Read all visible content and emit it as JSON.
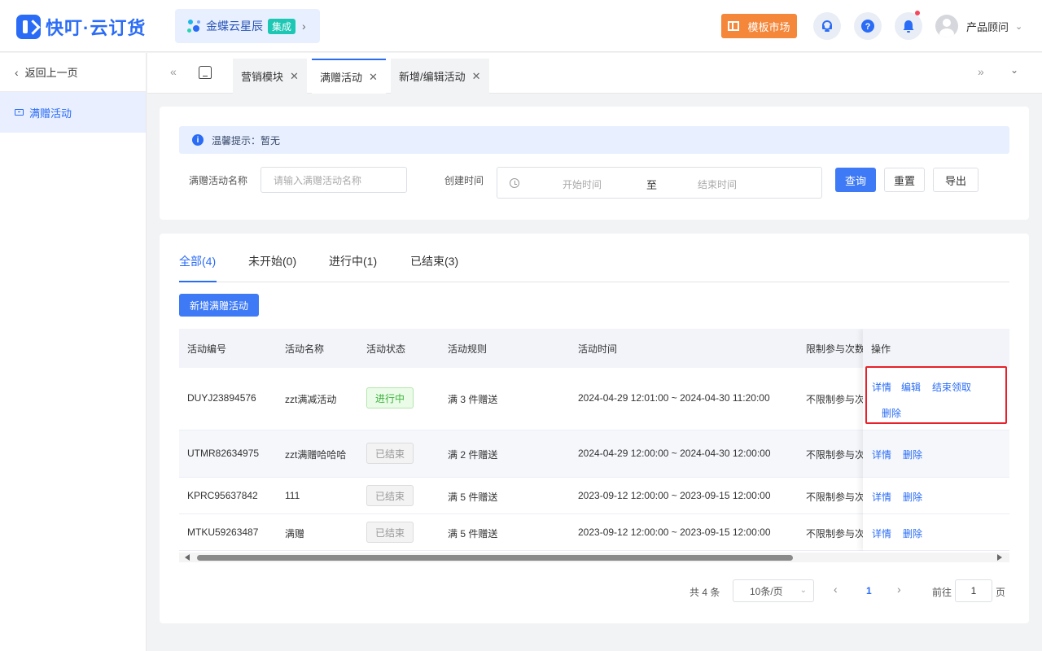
{
  "header": {
    "logo_text": "快叮·云订货",
    "tenant_name": "金蝶云星辰",
    "tenant_badge": "集成",
    "market_label": "模板市场",
    "user_name": "产品顾问"
  },
  "sidebar": {
    "back_label": "返回上一页",
    "items": [
      {
        "label": "满赠活动"
      }
    ]
  },
  "tabs": [
    {
      "label": "营销模块"
    },
    {
      "label": "满赠活动"
    },
    {
      "label": "新增/编辑活动"
    }
  ],
  "filter": {
    "tip_text": "温馨提示：暂无",
    "name_label": "满赠活动名称",
    "name_placeholder": "请输入满赠活动名称",
    "time_label": "创建时间",
    "start_placeholder": "开始时间",
    "range_sep": "至",
    "end_placeholder": "结束时间",
    "query_btn": "查询",
    "reset_btn": "重置",
    "export_btn": "导出"
  },
  "status_tabs": [
    {
      "label": "全部(4)"
    },
    {
      "label": "未开始(0)"
    },
    {
      "label": "进行中(1)"
    },
    {
      "label": "已结束(3)"
    }
  ],
  "add_btn": "新增满赠活动",
  "table": {
    "headers": [
      "活动编号",
      "活动名称",
      "活动状态",
      "活动规则",
      "活动时间",
      "限制参与次数",
      "操作"
    ],
    "rows": [
      {
        "code": "DUYJ23894576",
        "name": "zzt满减活动",
        "status": "进行中",
        "rule": "满 3 件赠送",
        "time": "2024-04-29 12:01:00 ~ 2024-04-30 11:20:00",
        "limit": "不限制参与次数",
        "ops": [
          "详情",
          "编辑",
          "结束领取",
          "删除"
        ]
      },
      {
        "code": "UTMR82634975",
        "name": "zzt满赠哈哈哈",
        "status": "已结束",
        "rule": "满 2 件赠送",
        "time": "2024-04-29 12:00:00 ~ 2024-04-30 12:00:00",
        "limit": "不限制参与次数",
        "ops": [
          "详情",
          "删除"
        ]
      },
      {
        "code": "KPRC95637842",
        "name": "111",
        "status": "已结束",
        "rule": "满 5 件赠送",
        "time": "2023-09-12 12:00:00 ~ 2023-09-15 12:00:00",
        "limit": "不限制参与次数",
        "ops": [
          "详情",
          "删除"
        ]
      },
      {
        "code": "MTKU59263487",
        "name": "满赠",
        "status": "已结束",
        "rule": "满 5 件赠送",
        "time": "2023-09-12 12:00:00 ~ 2023-09-15 12:00:00",
        "limit": "不限制参与次数",
        "ops": [
          "详情",
          "删除"
        ]
      }
    ]
  },
  "pagination": {
    "total": "共 4 条",
    "page_size": "10条/页",
    "current": "1",
    "goto_label": "前往",
    "goto_value": "1",
    "page_unit": "页"
  },
  "colors": {
    "primary": "#2a6cf6",
    "market": "#f5873a",
    "highlight": "#e8202a",
    "running": "#3bb43b"
  }
}
